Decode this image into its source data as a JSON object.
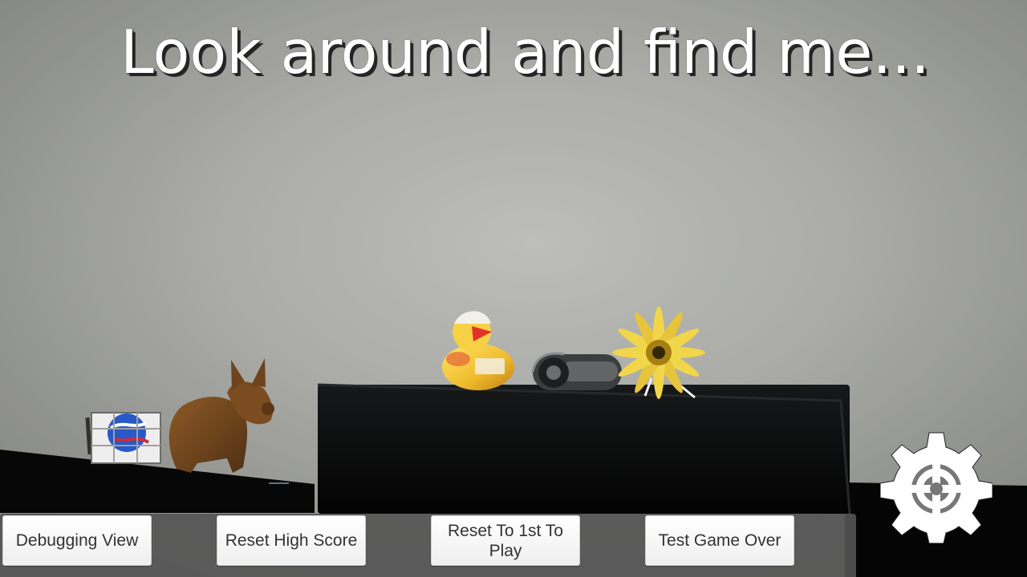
{
  "game": {
    "prompt": "Look around and find me..."
  },
  "debug_controls": {
    "debugging_view": "Debugging View",
    "reset_high_score": "Reset High Score",
    "reset_first_to_play": "Reset To 1st To Play",
    "test_game_over": "Test Game Over"
  },
  "icons": {
    "settings": "gear-icon"
  },
  "colors": {
    "prompt_text": "#ffffff",
    "button_text": "#333333",
    "panel": "#545454",
    "wall": "#b9bab5"
  }
}
